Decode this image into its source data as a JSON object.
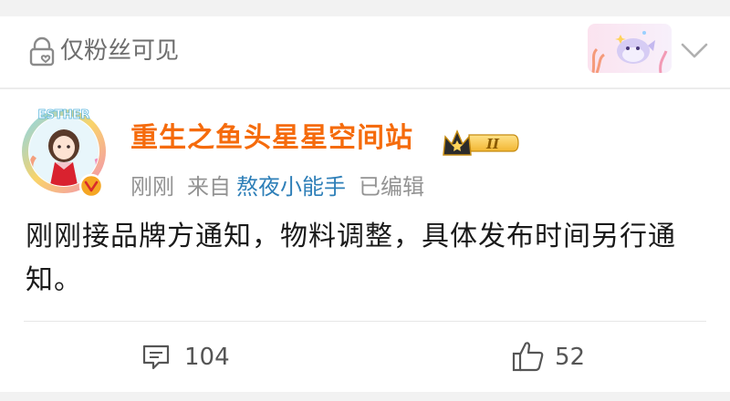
{
  "visibility": {
    "text": "仅粉丝可见",
    "icon": "lock-heart-icon"
  },
  "post": {
    "username": "重生之鱼头星星空间站",
    "badge_level": "II",
    "avatar_ring_text": "ESTHER",
    "time": "刚刚",
    "source_prefix": "来自",
    "source": "熬夜小能手",
    "edited": "已编辑",
    "content": "刚刚接品牌方通知，物料调整，具体发布时间另行通知。"
  },
  "actions": {
    "comment_count": "104",
    "like_count": "52"
  },
  "colors": {
    "username": "#f56b0c",
    "source_link": "#2e7fb8",
    "meta": "#939393",
    "verified_badge": "#f5a623"
  }
}
